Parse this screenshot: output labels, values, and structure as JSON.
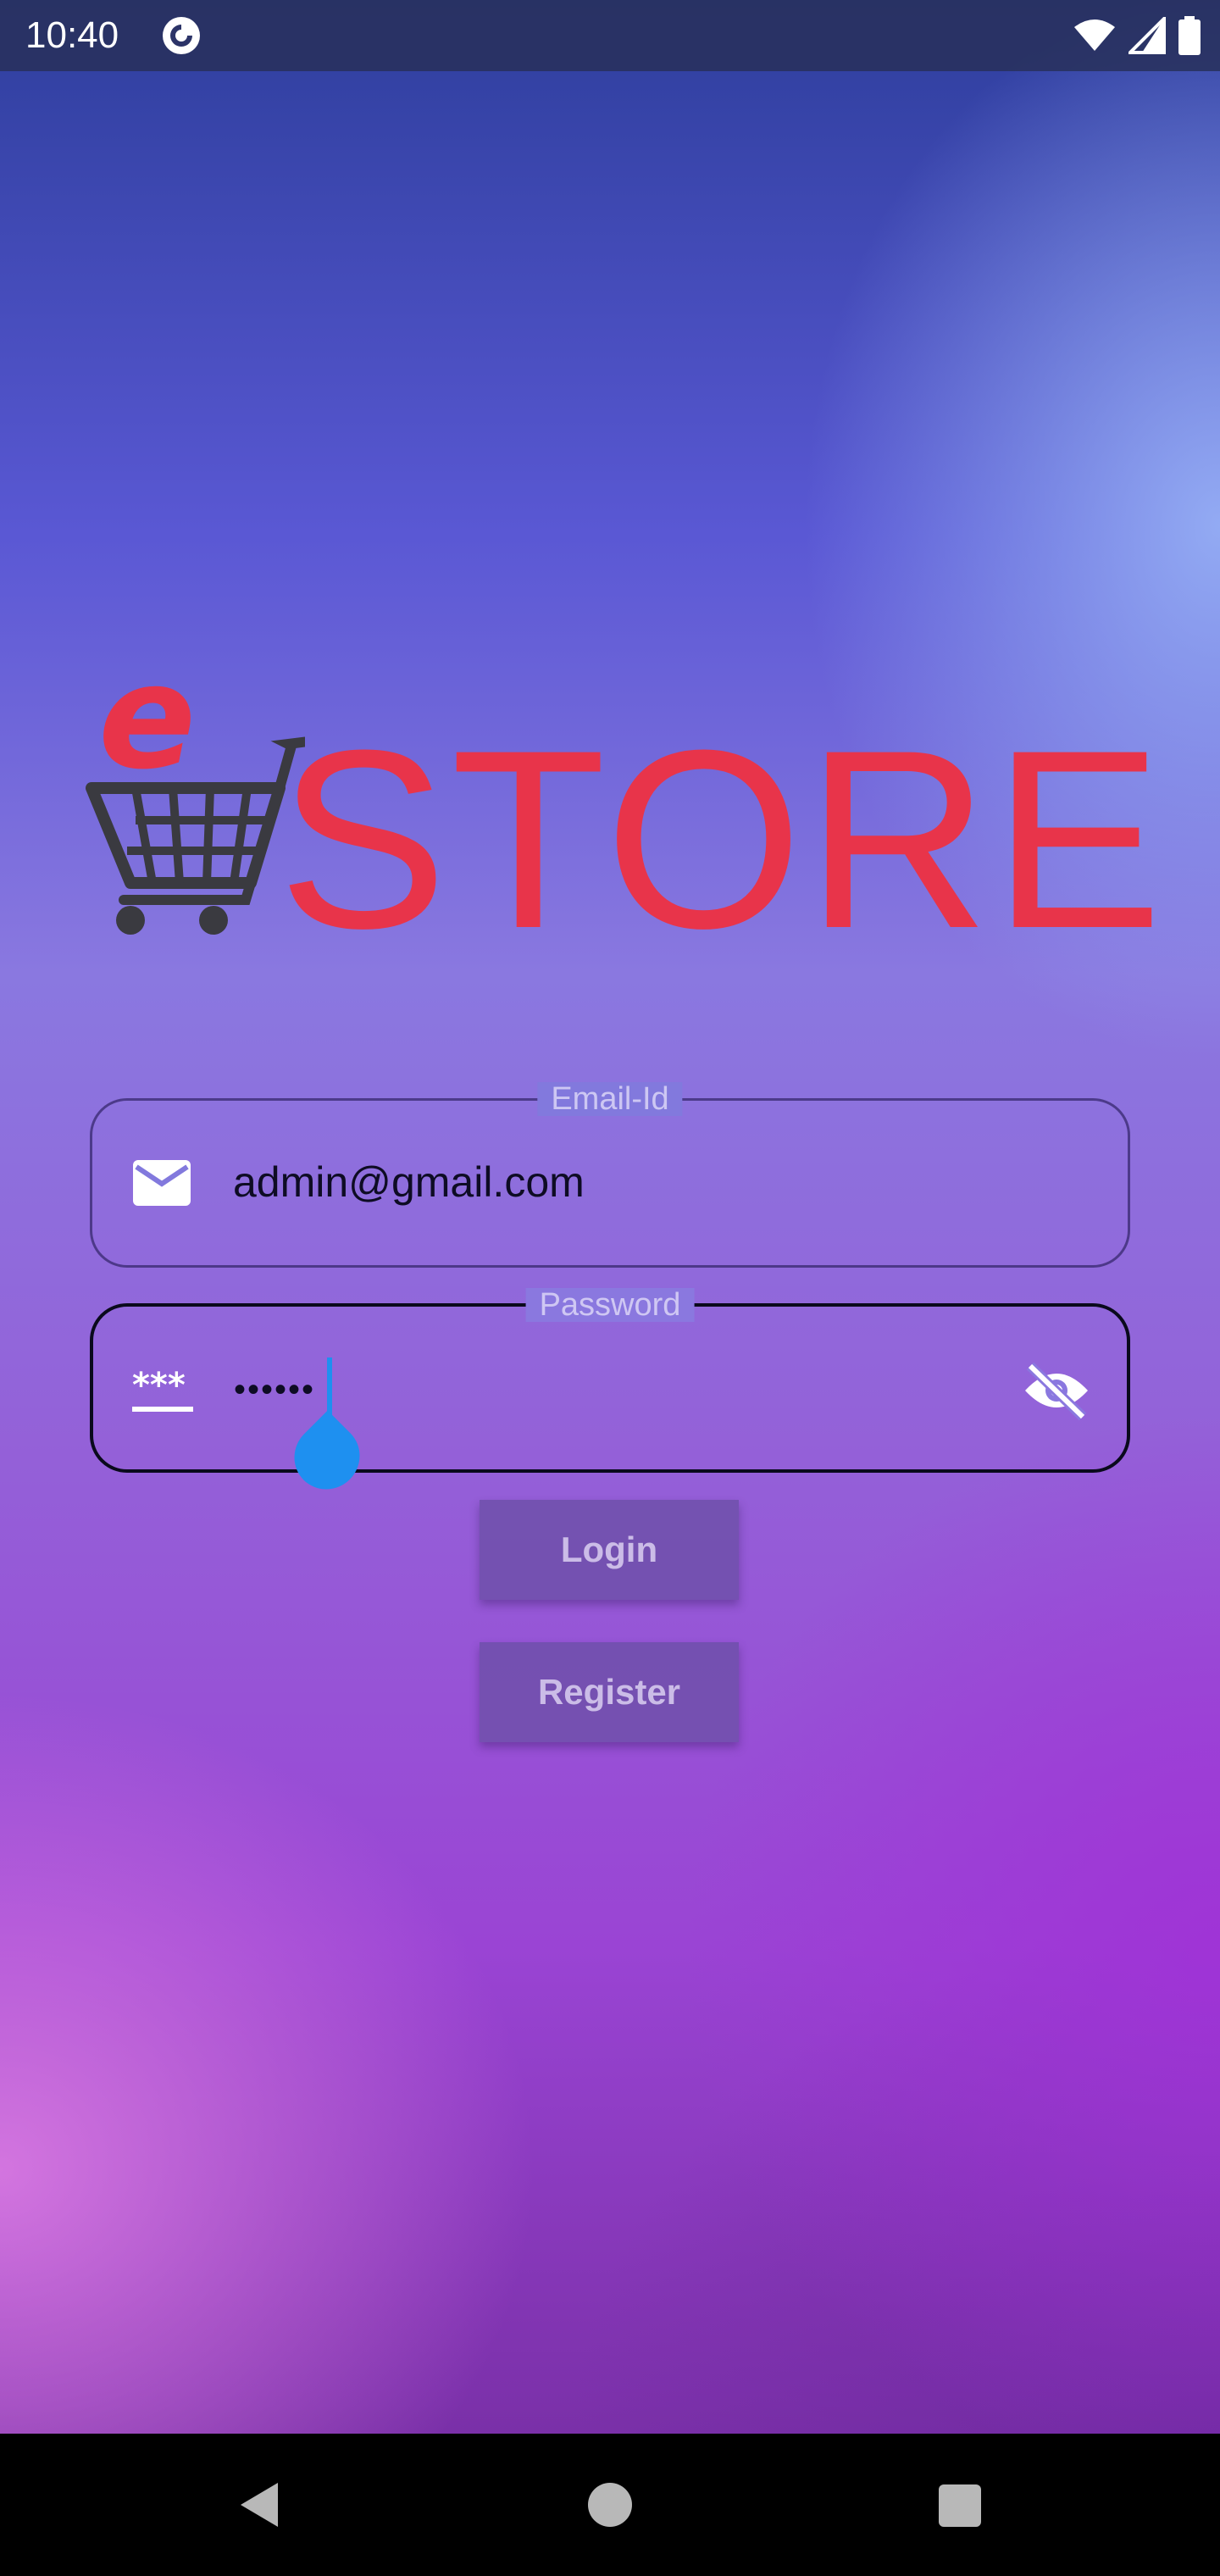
{
  "status_bar": {
    "time": "10:40",
    "app_icon": "pocket-casts-icon",
    "right_icons": [
      "wifi-icon",
      "cell-signal-icon",
      "battery-icon"
    ]
  },
  "logo": {
    "prefix": "e",
    "word": "STORE",
    "icon": "shopping-cart-icon",
    "brand_color": "#e8344a",
    "cart_color": "#3a3a40"
  },
  "form": {
    "email": {
      "label": "Email-Id",
      "value": "admin@gmail.com",
      "icon": "mail-icon"
    },
    "password": {
      "label": "Password",
      "masked_value": "••••••",
      "icon": "password-icon",
      "toggle_icon": "visibility-off-icon"
    },
    "login_label": "Login",
    "register_label": "Register"
  },
  "nav": {
    "back": "back-icon",
    "home": "home-icon",
    "recents": "recents-icon"
  },
  "colors": {
    "cursor": "#1e90f0",
    "text": "#0e0c24"
  }
}
